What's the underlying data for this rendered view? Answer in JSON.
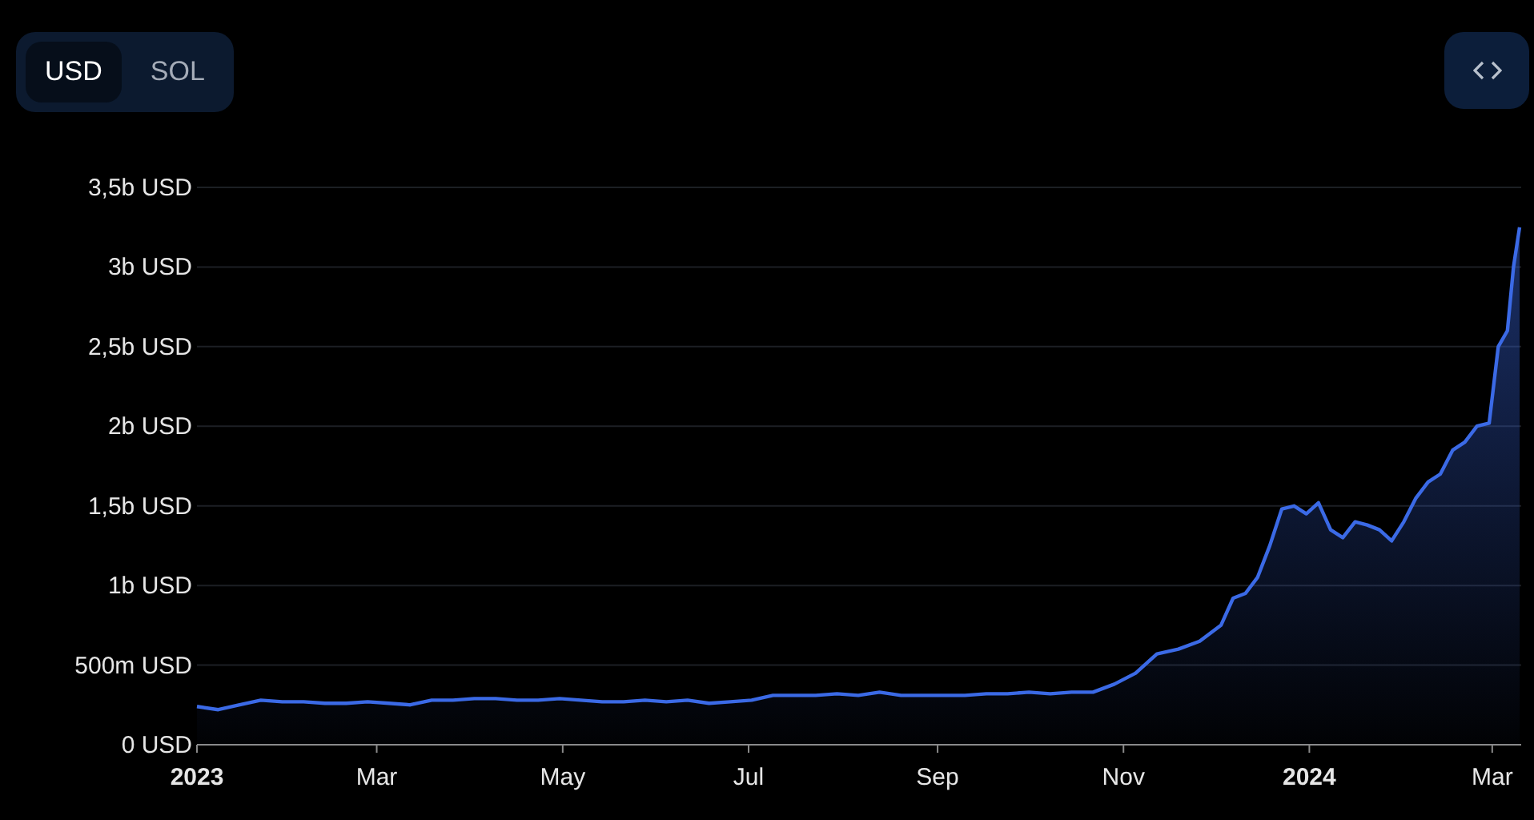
{
  "currency_toggle": [
    {
      "label": "USD",
      "selected": true
    },
    {
      "label": "SOL",
      "selected": false
    }
  ],
  "chart": {
    "chart_data": {
      "type": "area",
      "x": [
        2023,
        2023.0192,
        2023.0384,
        2023.0575,
        2023.0767,
        2023.0959,
        2023.1151,
        2023.1342,
        2023.1534,
        2023.1726,
        2023.1918,
        2023.211,
        2023.2301,
        2023.2493,
        2023.2685,
        2023.2877,
        2023.3068,
        2023.326,
        2023.3452,
        2023.3644,
        2023.3836,
        2023.4027,
        2023.4219,
        2023.4411,
        2023.4603,
        2023.4795,
        2023.4986,
        2023.5178,
        2023.537,
        2023.5562,
        2023.5753,
        2023.5945,
        2023.6137,
        2023.6329,
        2023.6521,
        2023.6712,
        2023.6904,
        2023.7096,
        2023.7288,
        2023.7479,
        2023.7671,
        2023.7863,
        2023.8055,
        2023.8247,
        2023.8438,
        2023.863,
        2023.8822,
        2023.9014,
        2023.9205,
        2023.9315,
        2023.9425,
        2023.9534,
        2023.9644,
        2023.9753,
        2023.9863,
        2023.9973,
        2024.0082,
        2024.0192,
        2024.0301,
        2024.0411,
        2024.0521,
        2024.063,
        2024.074,
        2024.0849,
        2024.0959,
        2024.1068,
        2024.1178,
        2024.1288,
        2024.1397,
        2024.1507,
        2024.1616,
        2024.1699,
        2024.1781,
        2024.1836,
        2024.189
      ],
      "series": [
        {
          "color": "#3b6ae6",
          "values": [
            240000000.0,
            220000000.0,
            250000000.0,
            280000000.0,
            270000000.0,
            270000000.0,
            260000000.0,
            260000000.0,
            270000000.0,
            260000000.0,
            250000000.0,
            280000000.0,
            280000000.0,
            290000000.0,
            290000000.0,
            280000000.0,
            280000000.0,
            290000000.0,
            280000000.0,
            270000000.0,
            270000000.0,
            280000000.0,
            270000000.0,
            280000000.0,
            260000000.0,
            270000000.0,
            280000000.0,
            310000000.0,
            310000000.0,
            310000000.0,
            320000000.0,
            310000000.0,
            330000000.0,
            310000000.0,
            310000000.0,
            310000000.0,
            310000000.0,
            320000000.0,
            320000000.0,
            330000000.0,
            320000000.0,
            330000000.0,
            330000000.0,
            380000000.0,
            450000000.0,
            570000000.0,
            600000000.0,
            650000000.0,
            750000000.0,
            920000000.0,
            950000000.0,
            1050000000.0,
            1250000000.0,
            1480000000.0,
            1500000000.0,
            1450000000.0,
            1520000000.0,
            1350000000.0,
            1300000000.0,
            1400000000.0,
            1380000000.0,
            1350000000.0,
            1280000000.0,
            1400000000.0,
            1550000000.0,
            1650000000.0,
            1700000000.0,
            1850000000.0,
            1900000000.0,
            2000000000.0,
            2020000000.0,
            2500000000.0,
            2600000000.0,
            3000000000.0,
            3250000000.0
          ]
        }
      ],
      "grid": true,
      "xlim": [
        2023,
        2024.189
      ],
      "ylim": [
        0,
        3500000000.0
      ],
      "xticks": [
        2023,
        {
          "value": 2023.1616,
          "label": "Mar"
        },
        {
          "value": 2023.3288,
          "label": "May"
        },
        {
          "value": 2023.4959,
          "label": "Jul"
        },
        {
          "value": 2023.6658,
          "label": "Sep"
        },
        {
          "value": 2023.8329,
          "label": "Nov"
        },
        2024,
        {
          "value": 2024.1644,
          "label": "Mar"
        }
      ],
      "yticks": [
        {
          "value": 0,
          "label": "0 USD"
        },
        {
          "value": 500000000.0,
          "label": "500m USD"
        },
        {
          "value": 1000000000.0,
          "label": "1b USD"
        },
        {
          "value": 1500000000.0,
          "label": "1,5b USD"
        },
        {
          "value": 2000000000.0,
          "label": "2b USD"
        },
        {
          "value": 2500000000.0,
          "label": "2,5b USD"
        },
        {
          "value": 3000000000.0,
          "label": "3b USD"
        },
        {
          "value": 3500000000.0,
          "label": "3,5b USD"
        }
      ]
    }
  }
}
